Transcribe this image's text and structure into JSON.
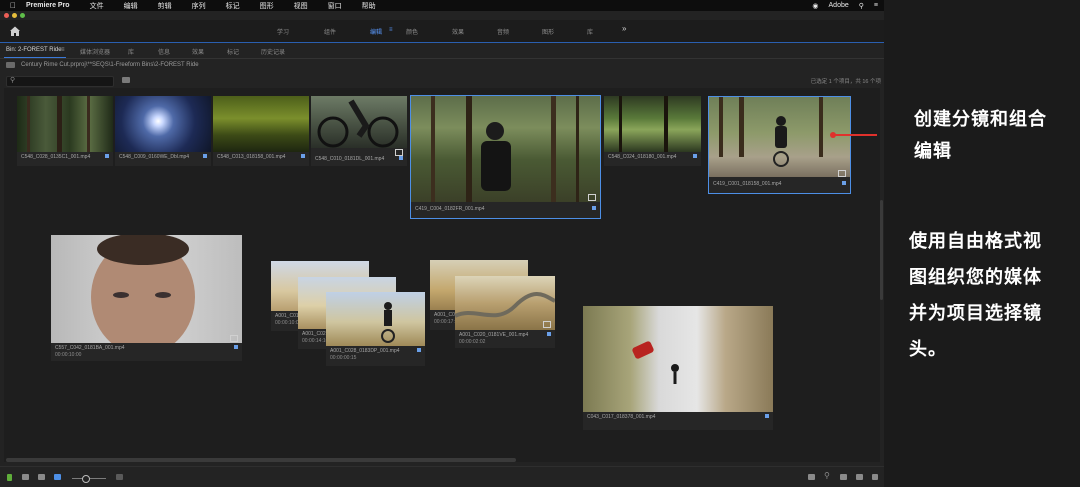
{
  "menubar": {
    "app_name": "Premiere Pro",
    "items": [
      "文件",
      "编辑",
      "剪辑",
      "序列",
      "标记",
      "图形",
      "视图",
      "窗口",
      "帮助"
    ],
    "right": "Adobe"
  },
  "workspaces": {
    "items": [
      "学习",
      "组件",
      "编辑",
      "颜色",
      "效果",
      "音频",
      "图形",
      "库"
    ],
    "active": "编辑",
    "more": "»"
  },
  "tabs": {
    "items": [
      "Bin: 2-FOREST Ride",
      "媒体浏览器",
      "库",
      "信息",
      "效果",
      "标记",
      "历史记录"
    ],
    "active": "Bin: 2-FOREST Ride"
  },
  "path": "Century Rime Cut.prproj\\**SEQS\\1-Freeform Bins\\2-FOREST Ride",
  "search": {
    "placeholder": ""
  },
  "counts": "已选定 1 个项目，共 16 个项",
  "clips": [
    {
      "name": "C548_C028_0135C1_001.mp4",
      "duration": ""
    },
    {
      "name": "C548_C009_0160WE_Dbl.mp4",
      "duration": ""
    },
    {
      "name": "C548_C013_018158_001.mp4",
      "duration": ""
    },
    {
      "name": "C548_C010_0181DL_001.mp4",
      "duration": ""
    },
    {
      "name": "C419_C004_0182FR_001.mp4",
      "duration": ""
    },
    {
      "name": "C548_C024_018180_001.mp4",
      "duration": ""
    },
    {
      "name": "C419_C001_018158_001.mp4",
      "duration": ""
    },
    {
      "name": "C557_C042_0181BA_001.mp4",
      "duration": "00:00:10:00"
    },
    {
      "name": "A001_C01...",
      "duration": "00:00:10:00"
    },
    {
      "name": "A001_C02...",
      "duration": "00:00:14:10"
    },
    {
      "name": "A001_C028_0183DP_001.mp4",
      "duration": "00:00:00:15"
    },
    {
      "name": "A001_C0...",
      "duration": "00:00:17:0"
    },
    {
      "name": "A001_C020_0181VE_001.mp4",
      "duration": "00:00:02:02"
    },
    {
      "name": "C043_C017_018378_001.mp4",
      "duration": ""
    }
  ],
  "annotations": {
    "callout1": [
      "创建分镜和组合",
      "编辑"
    ],
    "callout2": [
      "使用自由格式视",
      "图组织您的媒体",
      "并为项目选择镜",
      "头。"
    ]
  },
  "colors": {
    "accent": "#4d8fe6",
    "callout": "#e0312c"
  }
}
